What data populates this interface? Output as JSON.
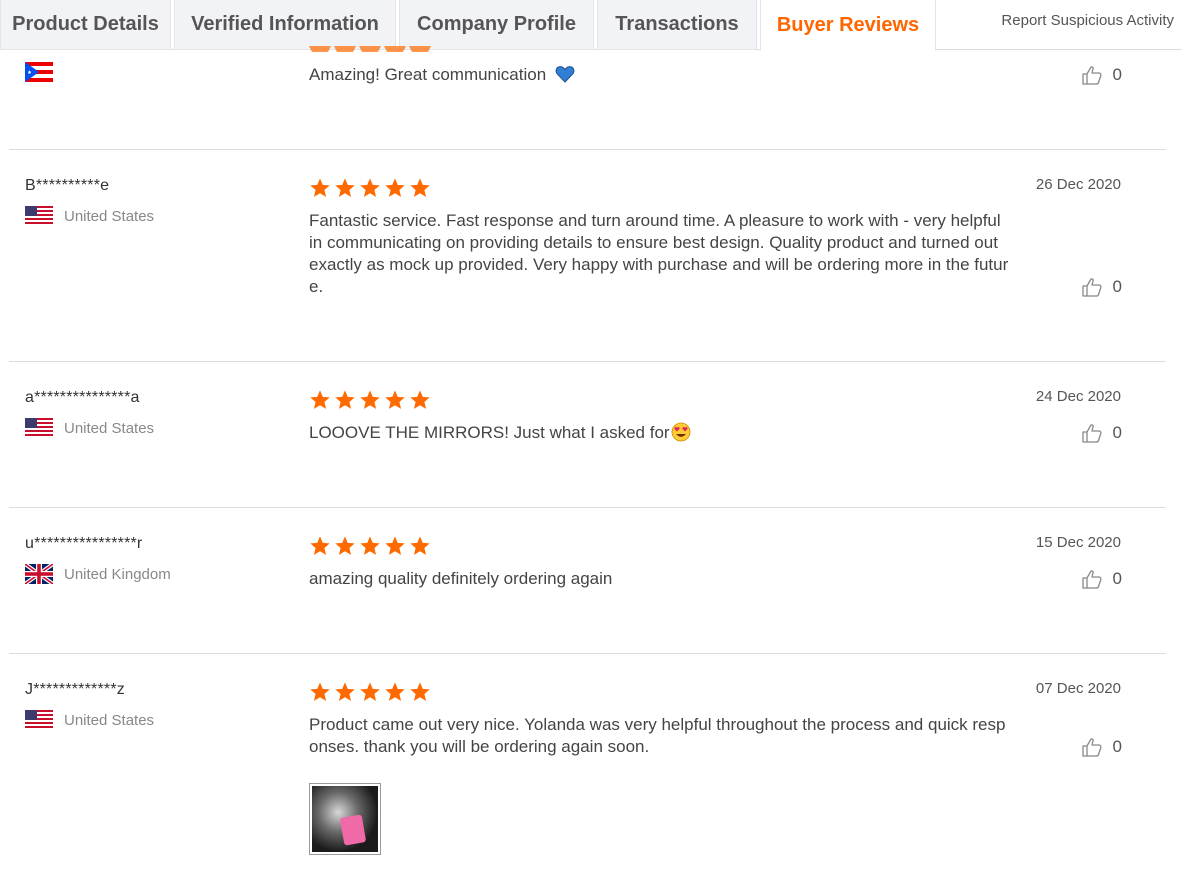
{
  "tabs": {
    "product_details": "Product Details",
    "verified_information": "Verified Information",
    "company_profile": "Company Profile",
    "transactions": "Transactions",
    "buyer_reviews": "Buyer Reviews",
    "report": "Report Suspicious Activity",
    "active": "Buyer Reviews"
  },
  "colors": {
    "accent": "#ff6600",
    "star": "#ff6a00"
  },
  "reviews": [
    {
      "buyer": "",
      "country": "",
      "flag": "puerto-rico-flag-icon",
      "rating": 5,
      "date": "",
      "comment": "Amazing! Great communication",
      "emoji": "blue-heart-icon",
      "likes": "0"
    },
    {
      "buyer": "B**********e",
      "country": "United States",
      "flag": "us-flag-icon",
      "rating": 5,
      "date": "26 Dec 2020",
      "comment": "Fantastic service. Fast response and turn around time. A pleasure to work with - very helpful in communicating on providing details to ensure best design. Quality product and turned out exactly as mock up provided. Very happy with purchase and will be ordering more in the future.",
      "likes": "0"
    },
    {
      "buyer": "a***************a",
      "country": "United States",
      "flag": "us-flag-icon",
      "rating": 5,
      "date": "24 Dec 2020",
      "comment": "LOOOVE THE MIRRORS! Just what I asked for",
      "emoji": "heart-eyes-icon",
      "likes": "0"
    },
    {
      "buyer": "u****************r",
      "country": "United Kingdom",
      "flag": "uk-flag-icon",
      "rating": 5,
      "date": "15 Dec 2020",
      "comment": "amazing quality definitely ordering again",
      "likes": "0"
    },
    {
      "buyer": "J*************z",
      "country": "United States",
      "flag": "us-flag-icon",
      "rating": 5,
      "date": "07 Dec 2020",
      "comment": "Product came out very nice. Yolanda was very helpful throughout the process and quick responses. thank you will be ordering again soon.",
      "likes": "0",
      "photo": "review-photo"
    }
  ]
}
